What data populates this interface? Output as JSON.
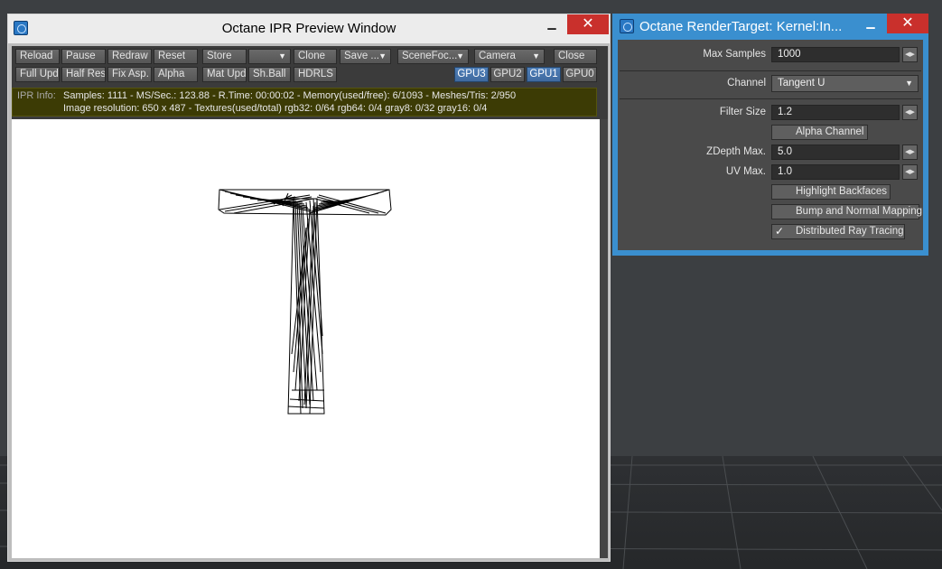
{
  "ipr_window": {
    "title": "Octane IPR Preview Window",
    "toolbar": {
      "row1": [
        "Reload",
        "Pause",
        "Redraw",
        "Reset",
        "Store",
        "",
        "Clone",
        "Save ...",
        "SceneFoc...",
        "Camera",
        "Close"
      ],
      "row2": [
        "Full Upd.",
        "Half Res",
        "Fix Asp.",
        "Alpha",
        "Mat Upd",
        "Sh.Ball",
        "HDRLS"
      ],
      "gpus": [
        "GPU3",
        "GPU2",
        "GPU1",
        "GPU0"
      ]
    },
    "info": {
      "label": "IPR Info:",
      "line1": "Samples: 1111  -  MS/Sec.: 123.88  -  R.Time: 00:00:02 - Memory(used/free): 6/1093  -  Meshes/Tris: 2/950",
      "line2": "Image resolution: 650 x 487 - Textures(used/total) rgb32: 0/64   rgb64: 0/4   gray8: 0/32   gray16: 0/4"
    }
  },
  "rt_window": {
    "title": "Octane RenderTarget: Kernel:In...",
    "max_samples": {
      "label": "Max Samples",
      "value": "1000"
    },
    "channel": {
      "label": "Channel",
      "value": "Tangent U"
    },
    "filter_size": {
      "label": "Filter Size",
      "value": "1.2"
    },
    "alpha_channel": {
      "label": "Alpha Channel",
      "checked": false
    },
    "zdepth_max": {
      "label": "ZDepth Max.",
      "value": "5.0"
    },
    "uv_max": {
      "label": "UV Max.",
      "value": "1.0"
    },
    "highlight_backfaces": {
      "label": "Highlight Backfaces",
      "checked": false
    },
    "bump_normal": {
      "label": "Bump and Normal Mapping",
      "checked": false
    },
    "distributed_rt": {
      "label": "Distributed Ray Tracing",
      "checked": true
    }
  },
  "icons": {
    "app": "octane-app-icon",
    "gpu_active": "GPU1"
  },
  "colors": {
    "accent_blue": "#3a8fcf",
    "close_red": "#c9302c",
    "info_bar": "#3c3b05"
  }
}
